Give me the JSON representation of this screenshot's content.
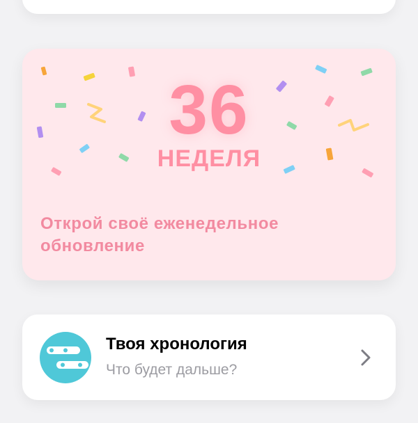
{
  "week_card": {
    "number": "36",
    "label": "НЕДЕЛЯ",
    "cta": "Открой своё еженедельное обновление"
  },
  "timeline_card": {
    "title": "Твоя хронология",
    "subtitle": "Что будет дальше?",
    "icon": "timeline-icon",
    "avatar_color": "#4fc8d8"
  },
  "colors": {
    "background": "#f2f2f4",
    "week_card_bg": "#ffe8ec",
    "accent_pink": "#ff8fa3"
  }
}
